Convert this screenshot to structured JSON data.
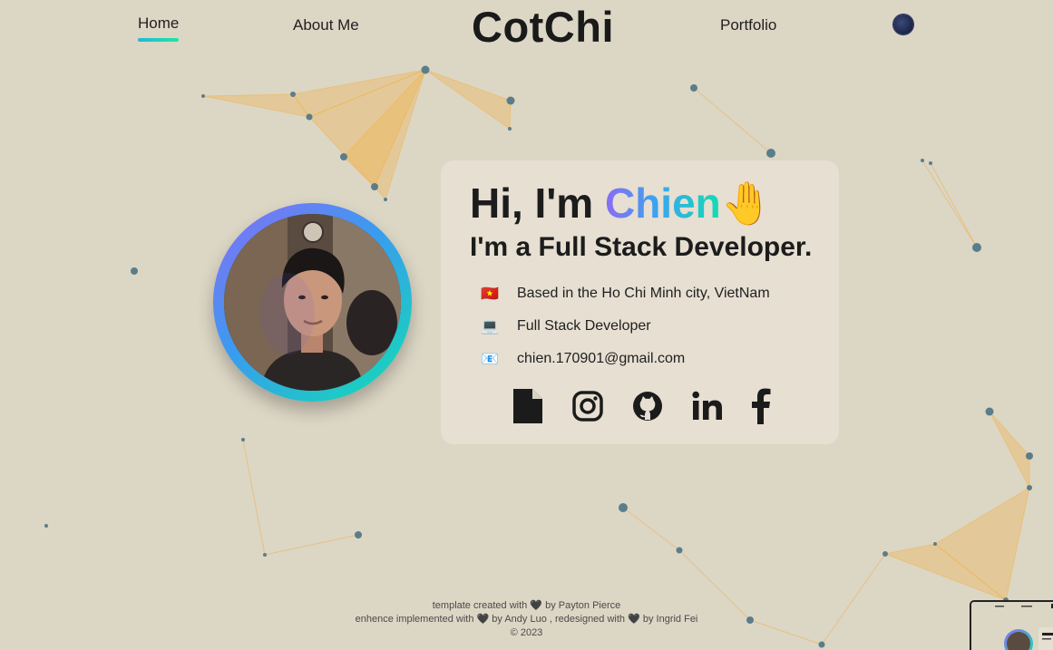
{
  "nav": {
    "home": "Home",
    "about": "About Me",
    "brand": "CotChi",
    "portfolio": "Portfolio"
  },
  "hero": {
    "greeting": "Hi, I'm ",
    "name": "Chien",
    "wave": "🤚",
    "role": "I'm a Full Stack Developer."
  },
  "info": [
    {
      "emoji": "🇻🇳",
      "text": "Based in the Ho Chi Minh city, VietNam"
    },
    {
      "emoji": "💻",
      "text": "Full Stack Developer"
    },
    {
      "emoji": "📧",
      "text": "chien.170901@gmail.com"
    }
  ],
  "social_icons": [
    "document-icon",
    "instagram-icon",
    "github-icon",
    "linkedin-icon",
    "facebook-icon"
  ],
  "footer": {
    "line1": "template created with 🖤 by Payton Pierce",
    "line2": "enhence implemented with 🖤 by Andy Luo , redesigned with 🖤 by Ingrid Fei",
    "line3": "© 2023"
  },
  "colors": {
    "background": "#dcd6c5",
    "card": "#e6dfd2",
    "accent_start": "#8a6bf4",
    "accent_end": "#14dcb2",
    "particles": "#5b7d8a",
    "polygons": "#f2b347"
  }
}
